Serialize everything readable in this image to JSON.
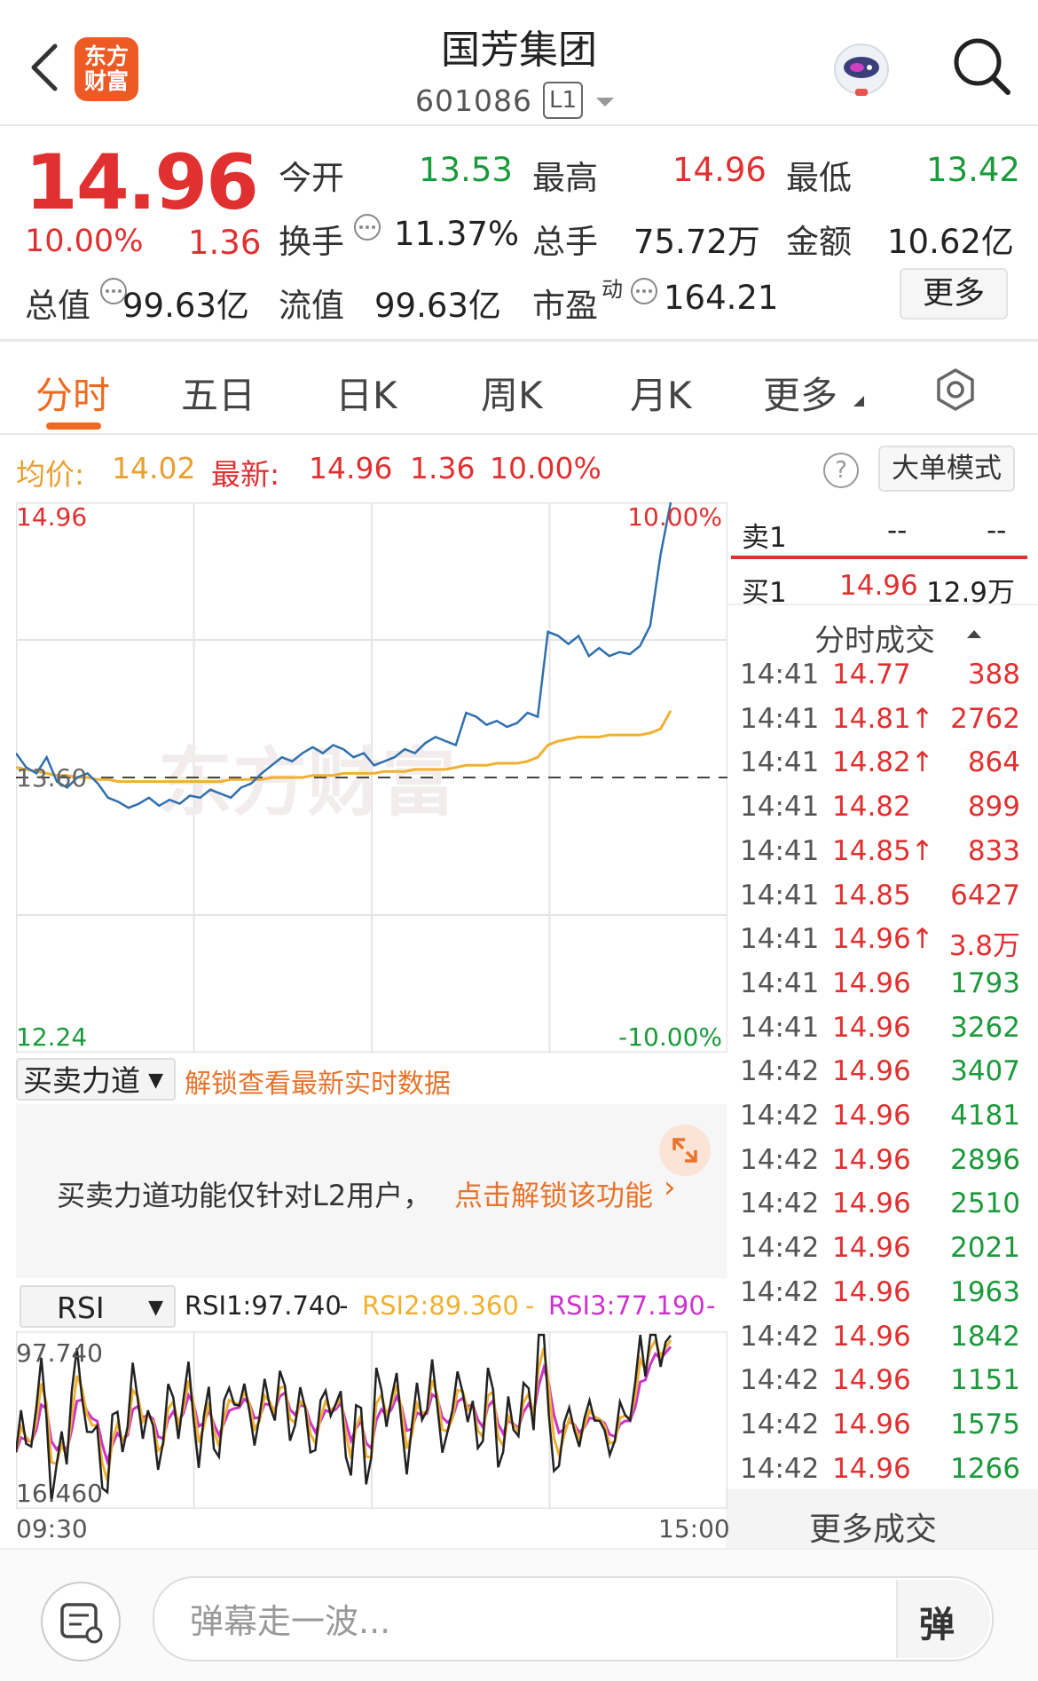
{
  "header": {
    "logo_text_line1": "东方",
    "logo_text_line2": "财富",
    "title": "国芳集团",
    "code": "601086",
    "level_badge": "L1",
    "back_icon": "chevron-left-icon",
    "assistant_icon": "robot-assistant-icon",
    "search_icon": "search-icon"
  },
  "quote": {
    "price": "14.96",
    "change_pct": "10.00%",
    "change": "1.36",
    "open_label": "今开",
    "open": "13.53",
    "high_label": "最高",
    "high": "14.96",
    "low_label": "最低",
    "low": "13.42",
    "turnover_label": "换手",
    "turnover": "11.37%",
    "volume_label": "总手",
    "volume": "75.72万",
    "amount_label": "金额",
    "amount": "10.62亿",
    "mktcap_label": "总值",
    "mktcap": "99.63亿",
    "float_label": "流值",
    "float": "99.63亿",
    "pe_label": "市盈",
    "pe_sup": "动",
    "pe": "164.21",
    "more_button": "更多"
  },
  "tabs": [
    "分时",
    "五日",
    "日K",
    "周K",
    "月K",
    "更多"
  ],
  "active_tab": 0,
  "legend": {
    "avg_label": "均价:",
    "avg_value": "14.02",
    "latest_label": "最新:",
    "latest_value": "14.96",
    "latest_change": "1.36",
    "latest_pct": "10.00%",
    "help": "?",
    "big_order_mode": "大单模式"
  },
  "chart_data": {
    "type": "line",
    "title": "",
    "x_start": "09:30",
    "x_end": "15:00",
    "ylim": [
      12.24,
      14.96
    ],
    "y_ref": 13.6,
    "y_top_label": "14.96",
    "y_bottom_label": "12.24",
    "y_ref_label": "13.60",
    "pct_top_label": "10.00%",
    "pct_bottom_label": "-10.00%",
    "series": [
      {
        "color": "#2e6fae",
        "values": [
          13.72,
          13.65,
          13.62,
          13.7,
          13.58,
          13.55,
          13.6,
          13.62,
          13.57,
          13.5,
          13.48,
          13.45,
          13.47,
          13.5,
          13.46,
          13.49,
          13.47,
          13.51,
          13.5,
          13.54,
          13.52,
          13.5,
          13.55,
          13.57,
          13.62,
          13.66,
          13.7,
          13.68,
          13.72,
          13.75,
          13.72,
          13.76,
          13.74,
          13.7,
          13.72,
          13.66,
          13.68,
          13.7,
          13.74,
          13.72,
          13.77,
          13.8,
          13.78,
          13.76,
          13.92,
          13.9,
          13.86,
          13.88,
          13.85,
          13.87,
          13.92,
          13.9,
          14.32,
          14.3,
          14.26,
          14.3,
          14.2,
          14.24,
          14.2,
          14.22,
          14.21,
          14.25,
          14.35,
          14.7,
          14.96
        ]
      },
      {
        "color": "#f0b030",
        "values": [
          13.65,
          13.64,
          13.63,
          13.62,
          13.61,
          13.61,
          13.6,
          13.6,
          13.59,
          13.59,
          13.58,
          13.58,
          13.58,
          13.58,
          13.58,
          13.58,
          13.58,
          13.58,
          13.58,
          13.58,
          13.58,
          13.59,
          13.59,
          13.59,
          13.59,
          13.6,
          13.6,
          13.6,
          13.6,
          13.61,
          13.61,
          13.61,
          13.62,
          13.62,
          13.62,
          13.62,
          13.63,
          13.63,
          13.63,
          13.64,
          13.64,
          13.64,
          13.64,
          13.65,
          13.66,
          13.66,
          13.66,
          13.67,
          13.67,
          13.67,
          13.68,
          13.7,
          13.76,
          13.78,
          13.79,
          13.8,
          13.8,
          13.8,
          13.81,
          13.81,
          13.81,
          13.81,
          13.82,
          13.84,
          13.93
        ]
      }
    ]
  },
  "orderbook": {
    "sell1_label": "卖1",
    "sell1_price": "--",
    "sell1_vol": "--",
    "buy1_label": "买1",
    "buy1_price": "14.96",
    "buy1_vol": "12.9万",
    "trades_title": "分时成交",
    "more_trades": "更多成交"
  },
  "trades": [
    {
      "time": "14:41",
      "price": "14.77",
      "vol": "388",
      "vc": "red"
    },
    {
      "time": "14:41",
      "price": "14.81↑",
      "vol": "2762",
      "vc": "red"
    },
    {
      "time": "14:41",
      "price": "14.82↑",
      "vol": "864",
      "vc": "red"
    },
    {
      "time": "14:41",
      "price": "14.82",
      "vol": "899",
      "vc": "red"
    },
    {
      "time": "14:41",
      "price": "14.85↑",
      "vol": "833",
      "vc": "red"
    },
    {
      "time": "14:41",
      "price": "14.85",
      "vol": "6427",
      "vc": "red"
    },
    {
      "time": "14:41",
      "price": "14.96↑",
      "vol": "3.8万",
      "vc": "red"
    },
    {
      "time": "14:41",
      "price": "14.96",
      "vol": "1793",
      "vc": "green"
    },
    {
      "time": "14:41",
      "price": "14.96",
      "vol": "3262",
      "vc": "green"
    },
    {
      "time": "14:42",
      "price": "14.96",
      "vol": "3407",
      "vc": "green"
    },
    {
      "time": "14:42",
      "price": "14.96",
      "vol": "4181",
      "vc": "green"
    },
    {
      "time": "14:42",
      "price": "14.96",
      "vol": "2896",
      "vc": "green"
    },
    {
      "time": "14:42",
      "price": "14.96",
      "vol": "2510",
      "vc": "green"
    },
    {
      "time": "14:42",
      "price": "14.96",
      "vol": "2021",
      "vc": "green"
    },
    {
      "time": "14:42",
      "price": "14.96",
      "vol": "1963",
      "vc": "green"
    },
    {
      "time": "14:42",
      "price": "14.96",
      "vol": "1842",
      "vc": "green"
    },
    {
      "time": "14:42",
      "price": "14.96",
      "vol": "1151",
      "vc": "green"
    },
    {
      "time": "14:42",
      "price": "14.96",
      "vol": "1575",
      "vc": "green"
    },
    {
      "time": "14:42",
      "price": "14.96",
      "vol": "1266",
      "vc": "green"
    }
  ],
  "power": {
    "select_label": "买卖力道",
    "unlock_hint": "解锁查看最新实时数据",
    "message_prefix": "买卖力道功能仅针对L2用户，",
    "message_link": "点击解锁该功能",
    "expand_icon": "expand-icon"
  },
  "rsi": {
    "select_label": "RSI",
    "rsi1": "RSI1:97.740",
    "rsi2": "RSI2:89.360",
    "rsi3": "RSI3:77.190",
    "sep": "-",
    "y_top": "97.740",
    "y_bottom": "16.460",
    "x_start": "09:30",
    "x_end": "15:00",
    "colors": {
      "rsi1": "#222222",
      "rsi2": "#f0b030",
      "rsi3": "#cc33cc"
    }
  },
  "bottom": {
    "placeholder": "弹幕走一波...",
    "send_label": "弹",
    "chat_icon": "chat-list-icon"
  }
}
